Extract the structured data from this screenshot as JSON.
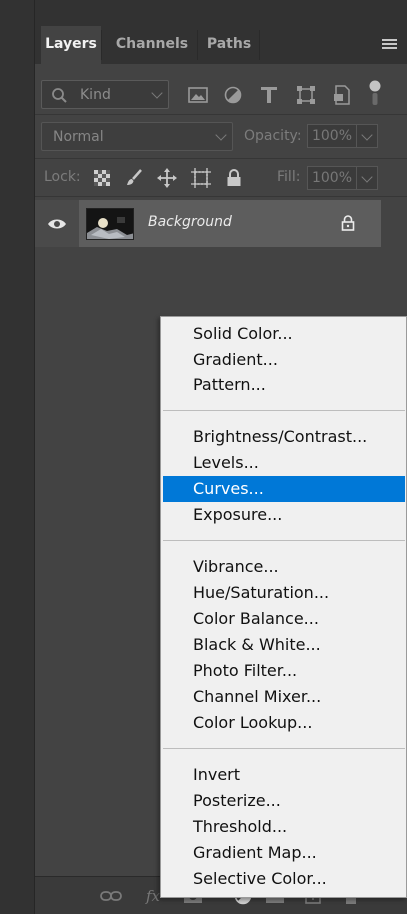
{
  "tabs": [
    {
      "label": "Layers",
      "active": true
    },
    {
      "label": "Channels",
      "active": false
    },
    {
      "label": "Paths",
      "active": false
    }
  ],
  "filter": {
    "kind_label": "Kind",
    "icons": [
      "image-filter-icon",
      "adjustment-filter-icon",
      "type-filter-icon",
      "shape-filter-icon",
      "smart-object-filter-icon"
    ]
  },
  "blend": {
    "mode": "Normal",
    "opacity_label": "Opacity:",
    "opacity_value": "100%"
  },
  "lock": {
    "label": "Lock:",
    "fill_label": "Fill:",
    "fill_value": "100%"
  },
  "layers": [
    {
      "name": "Background",
      "visible": true,
      "locked": true
    }
  ],
  "footer": {
    "fx_label": "fx"
  },
  "menu": {
    "groups": [
      [
        "Solid Color...",
        "Gradient...",
        "Pattern..."
      ],
      [
        "Brightness/Contrast...",
        "Levels...",
        "Curves...",
        "Exposure..."
      ],
      [
        "Vibrance...",
        "Hue/Saturation...",
        "Color Balance...",
        "Black & White...",
        "Photo Filter...",
        "Channel Mixer...",
        "Color Lookup..."
      ],
      [
        "Invert",
        "Posterize...",
        "Threshold...",
        "Gradient Map...",
        "Selective Color..."
      ]
    ],
    "selected": "Curves..."
  },
  "colors": {
    "panel_bg": "#434343",
    "menu_bg": "#f0f0f0",
    "selection": "#0078d7"
  }
}
